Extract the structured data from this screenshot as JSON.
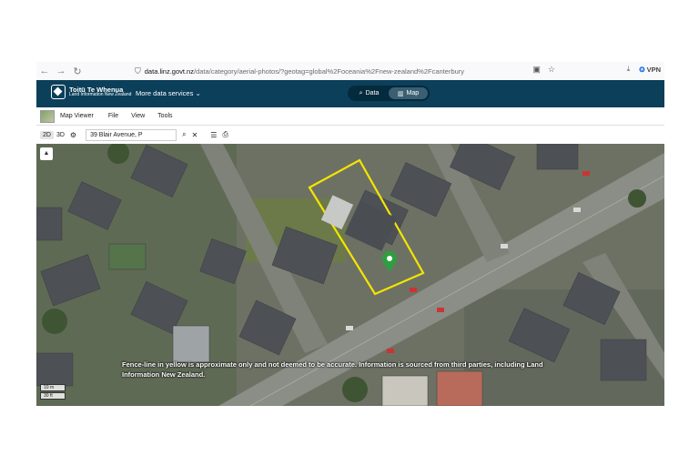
{
  "browser": {
    "url_domain": "data.linz.govt.nz",
    "url_path": "/data/category/aerial-photos/?geotag=global%2Foceania%2Fnew-zealand%2Fcanterbury",
    "vpn_label": "VPN"
  },
  "header": {
    "logo_line1": "Toitū Te Whenua",
    "logo_line2": "Land Information New Zealand",
    "more_data": "More data services",
    "toggle": [
      {
        "label": "Data",
        "icon": "search-icon",
        "active": false
      },
      {
        "label": "Map",
        "icon": "map-icon",
        "active": true
      }
    ]
  },
  "viewer": {
    "title": "Map Viewer",
    "menus": [
      "File",
      "View",
      "Tools"
    ]
  },
  "toolbar": {
    "mode_2d": "2D",
    "mode_3d": "3D",
    "search_value": "39 Blair Avenue, P"
  },
  "map": {
    "compass": "▲",
    "disclaimer": "Fence-line in yellow is approximate only and not deemed to be accurate. Information is sourced from third parties, including Land Information New Zealand.",
    "scale_top": "10 m",
    "scale_bottom": "30 ft",
    "colors": {
      "boundary": "#f5e400",
      "marker": "#2e9e3f",
      "road": "#8b8e86"
    }
  }
}
